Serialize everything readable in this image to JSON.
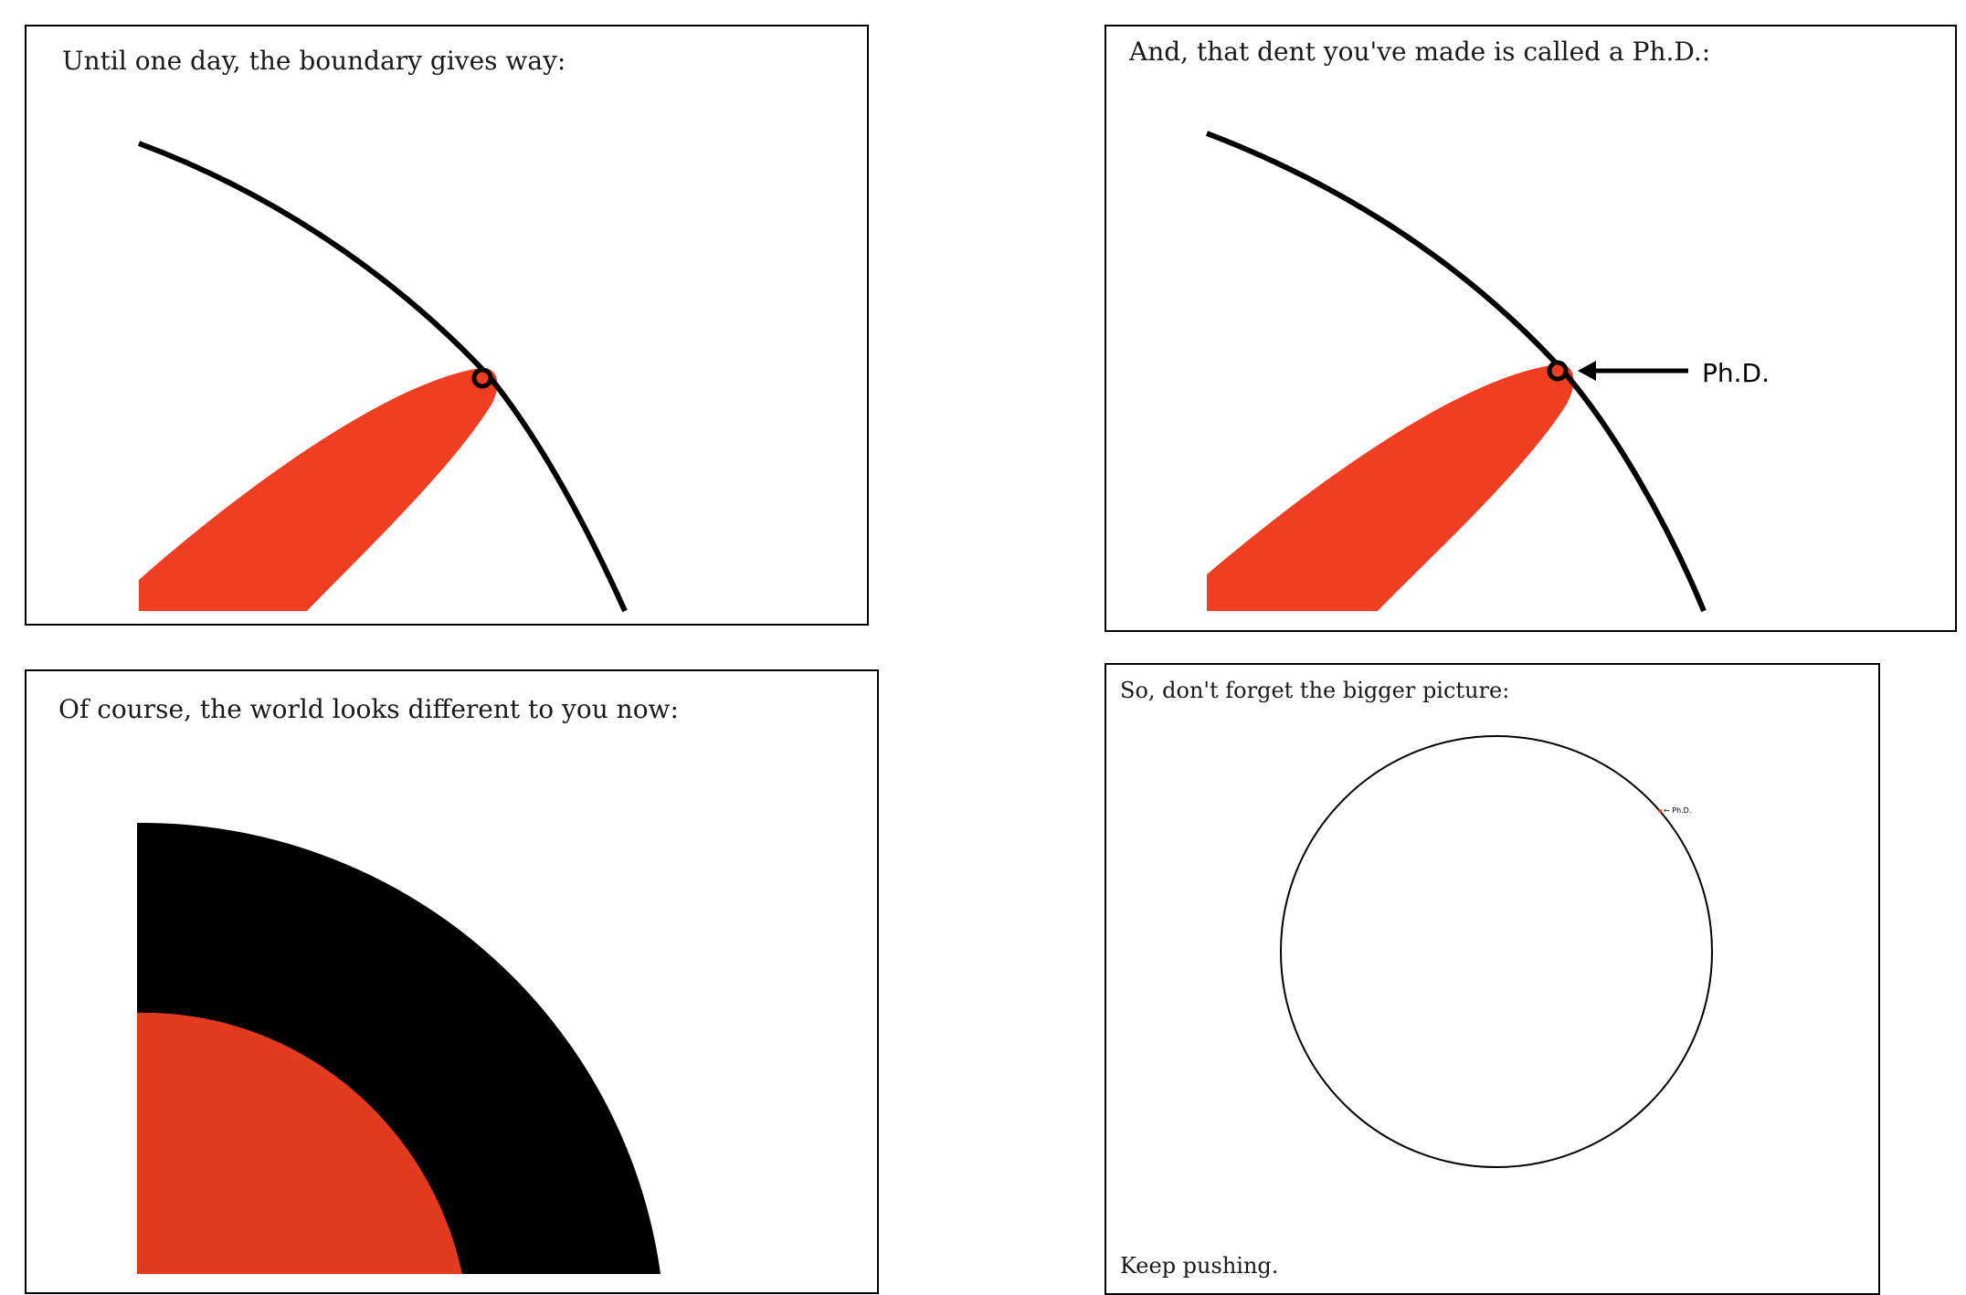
{
  "colors": {
    "inner_red": "#f03e22",
    "inner_red_dark": "#e33b1f",
    "boundary": "#000000",
    "background": "#ffffff"
  },
  "panels": [
    {
      "id": "p1",
      "caption": "Until one day, the boundary gives way:"
    },
    {
      "id": "p2",
      "caption": "And, that dent you've made is called a Ph.D.:",
      "label": "Ph.D."
    },
    {
      "id": "p3",
      "caption": "Of course, the world looks different to you now:"
    },
    {
      "id": "p4",
      "caption": "So, don't forget the bigger picture:",
      "tiny_label": "← Ph.D.",
      "footer": "Keep pushing."
    }
  ]
}
